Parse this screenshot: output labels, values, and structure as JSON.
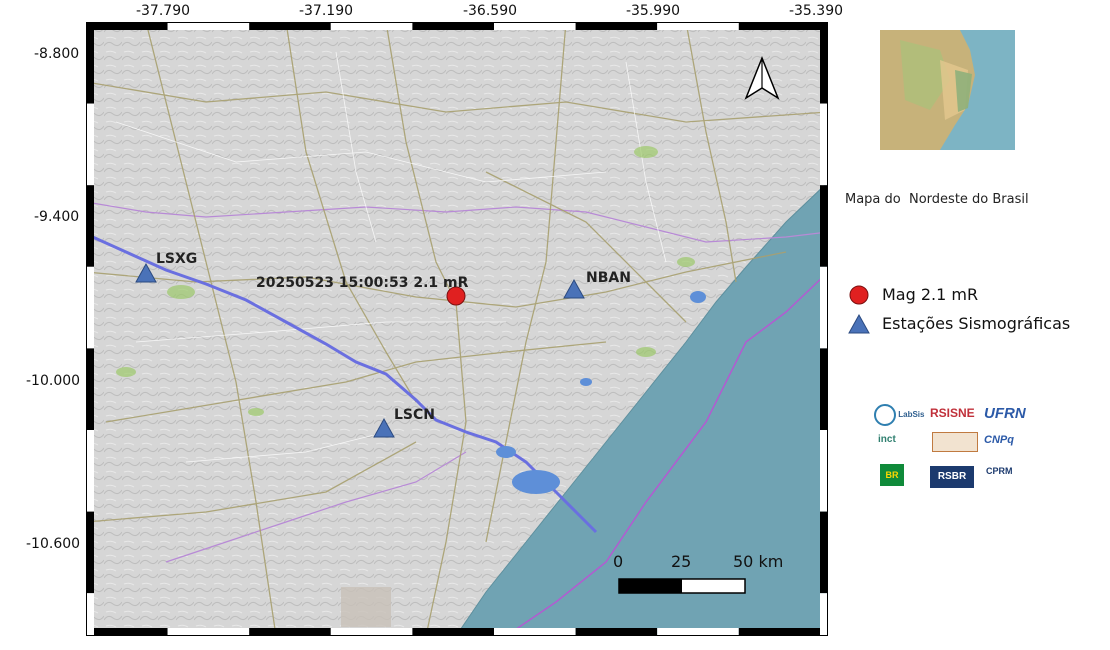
{
  "map": {
    "lon_ticks": [
      "-37.790",
      "-37.190",
      "-36.590",
      "-35.990",
      "-35.390"
    ],
    "lat_ticks": [
      "-8.800",
      "-9.400",
      "-10.000",
      "-10.600"
    ],
    "north_arrow_icon": "north-arrow-icon",
    "event_label": "20250523 15:00:53 2.1 mR",
    "stations": [
      {
        "code": "LSXG"
      },
      {
        "code": "NBAN"
      },
      {
        "code": "LSCN"
      }
    ],
    "scale_bar": {
      "labels": [
        "0",
        "25",
        "50 km"
      ]
    },
    "colors": {
      "sea": "#70a3b3",
      "land": "#d4d4d4",
      "river": "#6a6fe0",
      "event": "#e02020",
      "station": "#4a72b8"
    }
  },
  "inset": {
    "caption": "Mapa do  Nordeste do Brasil"
  },
  "legend": {
    "items": [
      {
        "label": "Mag 2.1 mR",
        "symbol": "red-circle"
      },
      {
        "label": "Estações Sismográficas",
        "symbol": "blue-triangle"
      }
    ]
  },
  "logos": {
    "labsis": "LabSis",
    "labsis_sub": "UFRN",
    "rsisne": "RSISNE",
    "ufrn": "UFRN",
    "inct": "inct",
    "cnpq": "CNPq",
    "petrobras": "BR",
    "rsbr": "RSBR",
    "cprm": "CPRM"
  }
}
